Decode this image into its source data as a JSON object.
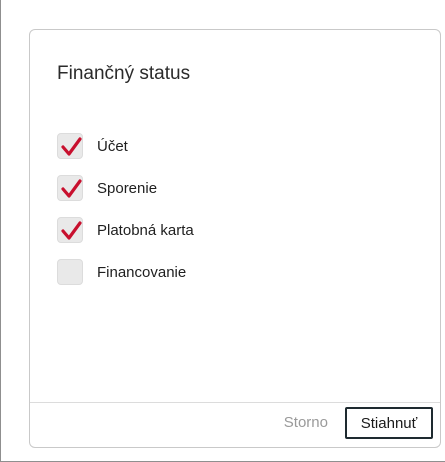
{
  "dialog": {
    "title": "Finančný status",
    "options": [
      {
        "label": "Účet",
        "checked": true
      },
      {
        "label": "Sporenie",
        "checked": true
      },
      {
        "label": "Platobná karta",
        "checked": true
      },
      {
        "label": "Financovanie",
        "checked": false
      }
    ],
    "cancel_label": "Storno",
    "download_label": "Stiahnuť"
  },
  "colors": {
    "checkmark": "#c8102e",
    "checkbox_bg": "#e9e9e9",
    "button_border": "#1e2a30"
  }
}
